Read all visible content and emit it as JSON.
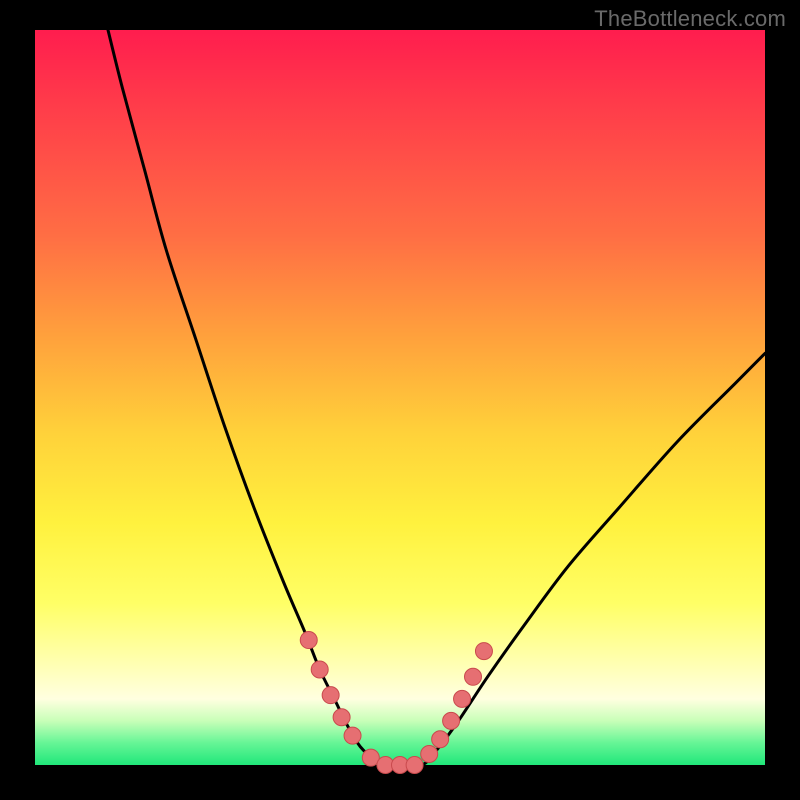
{
  "watermark": "TheBottleneck.com",
  "colors": {
    "frame": "#000000",
    "gradient_top": "#ff1d4e",
    "gradient_bottom": "#20e77a",
    "curve": "#000000",
    "marker_fill": "#e66f72",
    "marker_stroke": "#c94a4d"
  },
  "chart_data": {
    "type": "line",
    "title": "",
    "xlabel": "",
    "ylabel": "",
    "xlim": [
      0,
      100
    ],
    "ylim": [
      0,
      100
    ],
    "series": [
      {
        "name": "bottleneck-curve",
        "x": [
          10,
          12,
          15,
          18,
          22,
          26,
          30,
          34,
          37,
          39,
          41,
          43,
          45,
          48,
          50,
          53,
          55,
          58,
          62,
          67,
          73,
          80,
          88,
          96,
          100
        ],
        "y": [
          100,
          92,
          81,
          70,
          58,
          46,
          35,
          25,
          18,
          13,
          9,
          5,
          2,
          0,
          0,
          0,
          2,
          6,
          12,
          19,
          27,
          35,
          44,
          52,
          56
        ]
      }
    ],
    "markers": {
      "name": "highlight-points",
      "x": [
        37.5,
        39,
        40.5,
        42,
        43.5,
        46,
        48,
        50,
        52,
        54,
        55.5,
        57,
        58.5,
        60,
        61.5
      ],
      "y": [
        17,
        13,
        9.5,
        6.5,
        4,
        1,
        0,
        0,
        0,
        1.5,
        3.5,
        6,
        9,
        12,
        15.5
      ]
    }
  }
}
